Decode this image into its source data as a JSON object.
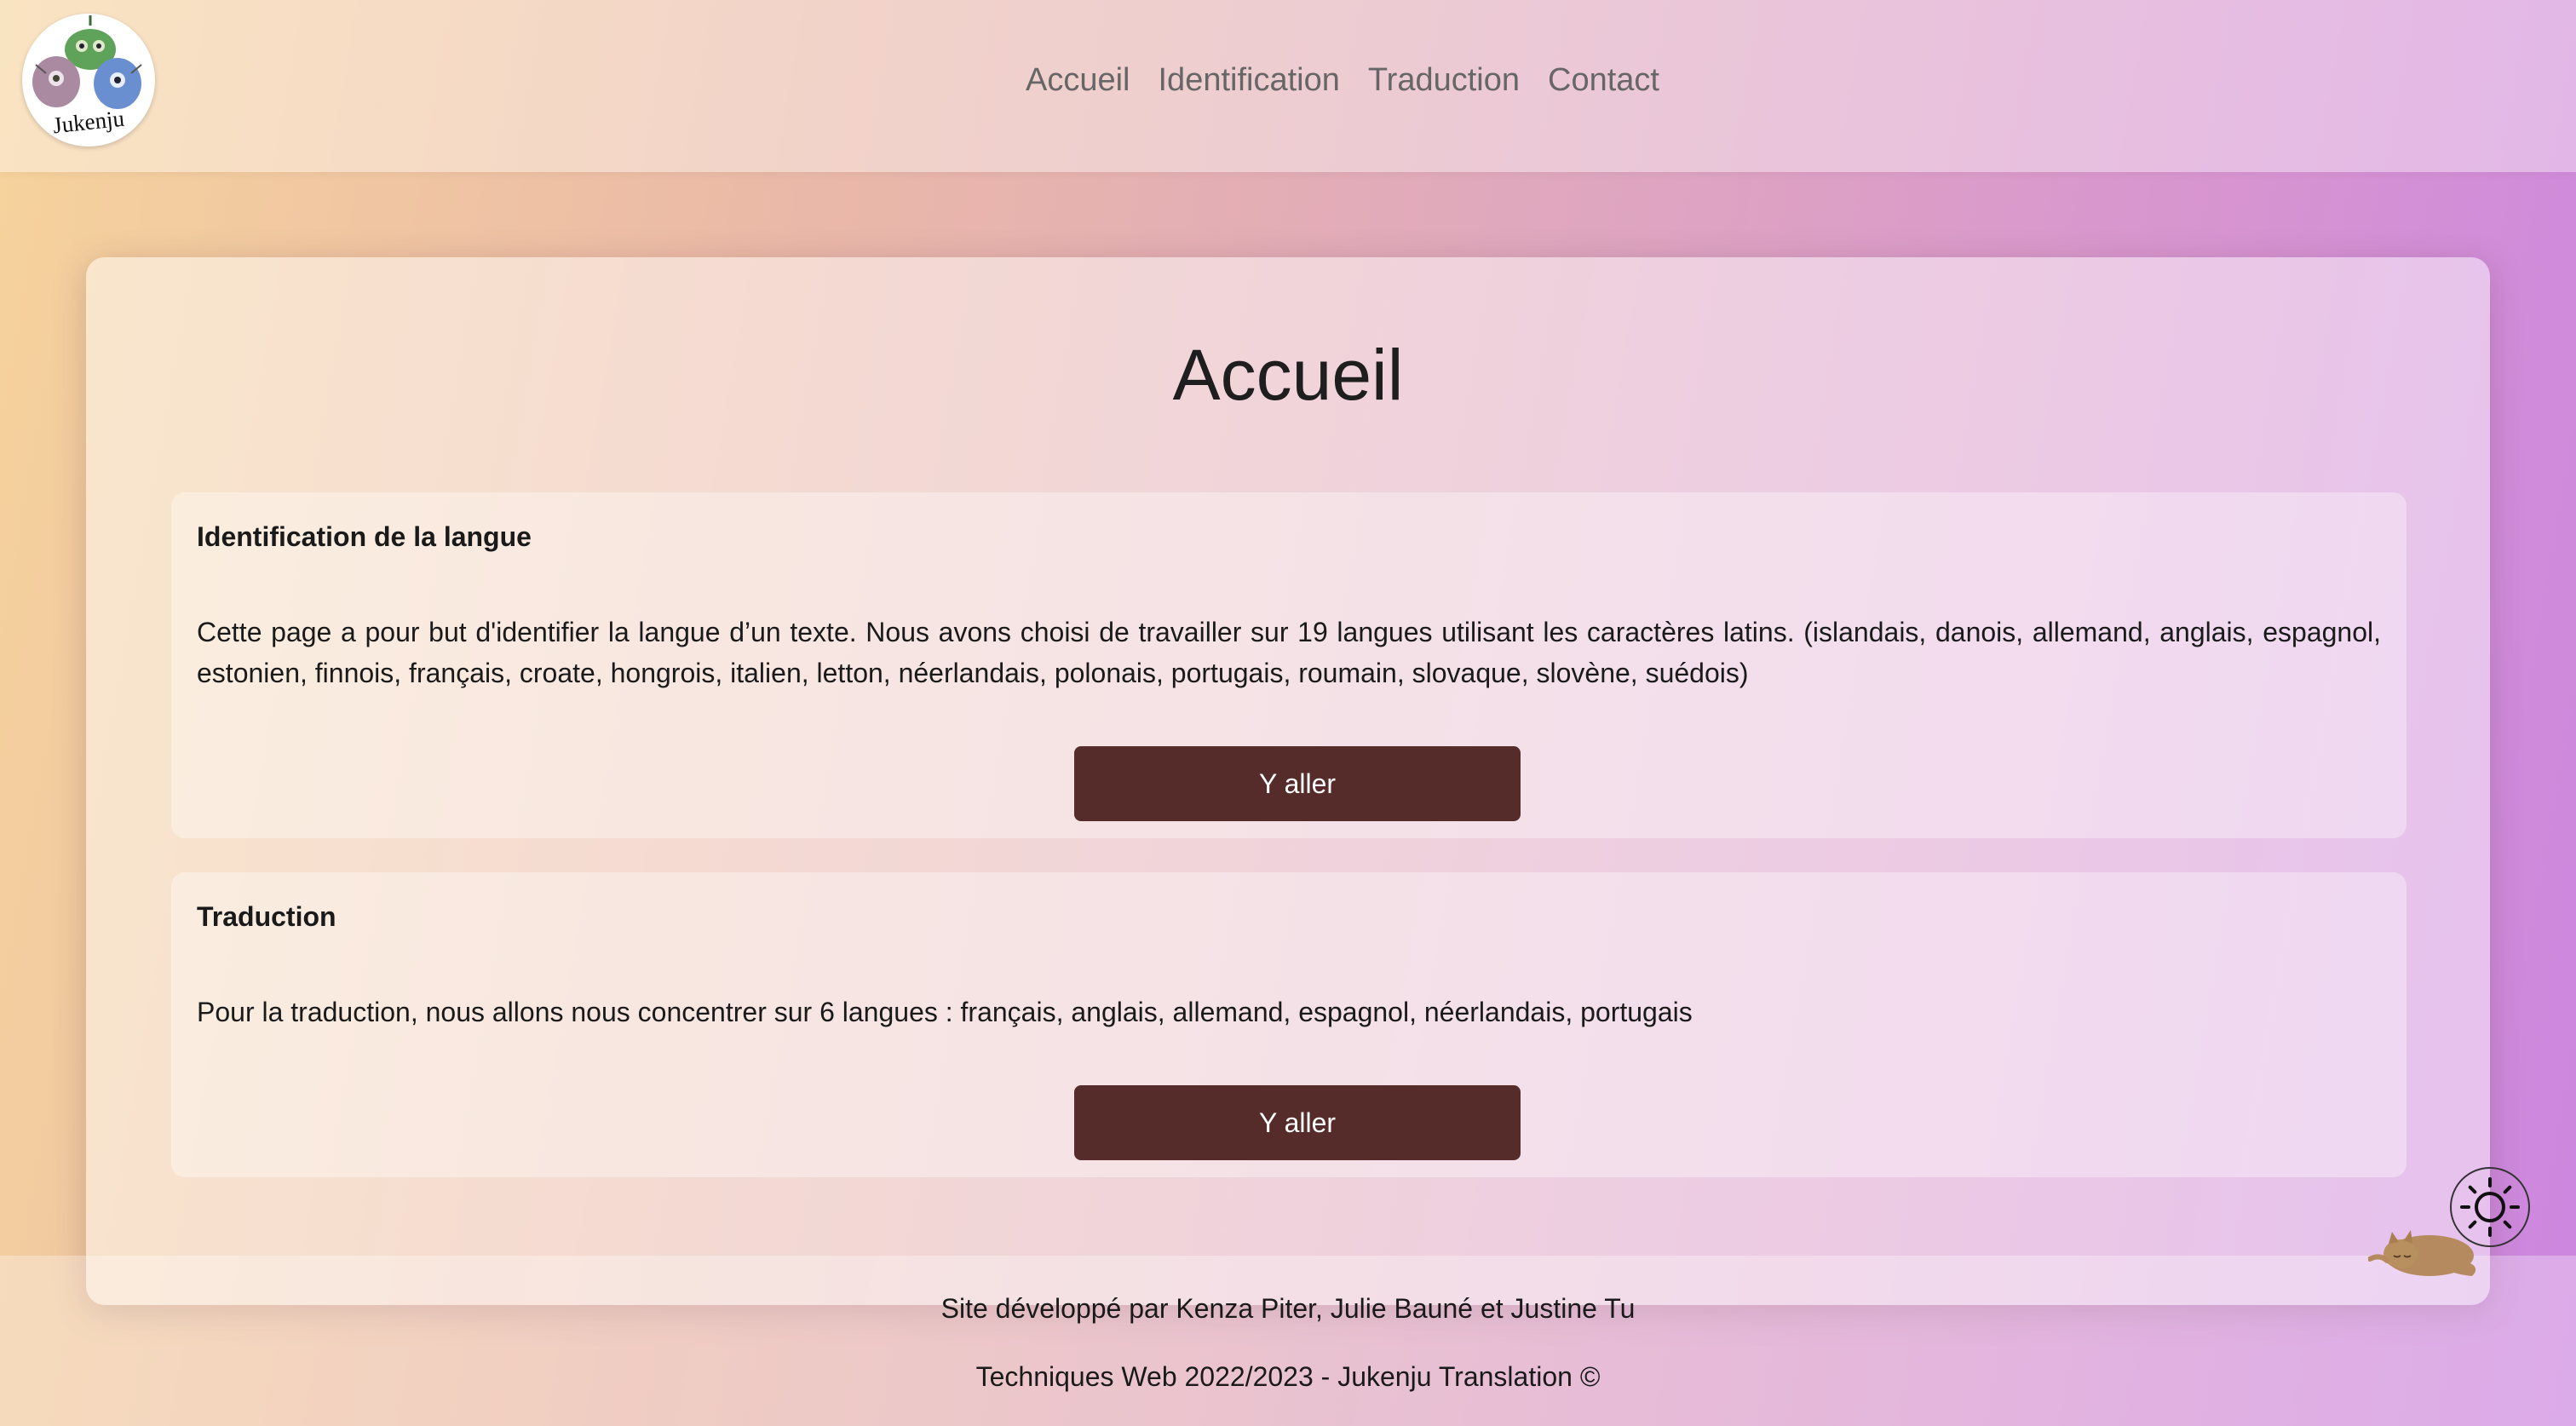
{
  "header": {
    "logo_text": "Jukenju",
    "nav": [
      {
        "label": "Accueil"
      },
      {
        "label": "Identification"
      },
      {
        "label": "Traduction"
      },
      {
        "label": "Contact"
      }
    ]
  },
  "main": {
    "title": "Accueil",
    "sections": [
      {
        "heading": "Identification de la langue",
        "text": "Cette page a pour but d'identifier la langue d’un texte. Nous avons choisi de travailler sur 19 langues utilisant les caractères latins. (islandais, danois, allemand, anglais, espagnol, estonien, finnois, français, croate, hongrois, italien, letton, néerlandais, polonais, portugais, roumain, slovaque, slovène, suédois)",
        "button_label": "Y aller"
      },
      {
        "heading": "Traduction",
        "text": "Pour la traduction, nous allons nous concentrer sur 6 langues : français, anglais, allemand, espagnol, néerlandais, portugais",
        "button_label": "Y aller"
      }
    ]
  },
  "footer": {
    "credits": "Site développé par Kenza Piter, Julie Bauné et Justine Tu",
    "copyright": "Techniques Web 2022/2023 - Jukenju Translation ©"
  },
  "theme_toggle": {
    "icon": "sun-icon"
  },
  "decor": {
    "cat_icon": "sleeping-cat-icon"
  },
  "colors": {
    "button_bg": "#552c29",
    "button_text": "#ffffff",
    "nav_text": "#666666",
    "gradient_start": "#f6d39c",
    "gradient_end": "#cc86e0"
  }
}
